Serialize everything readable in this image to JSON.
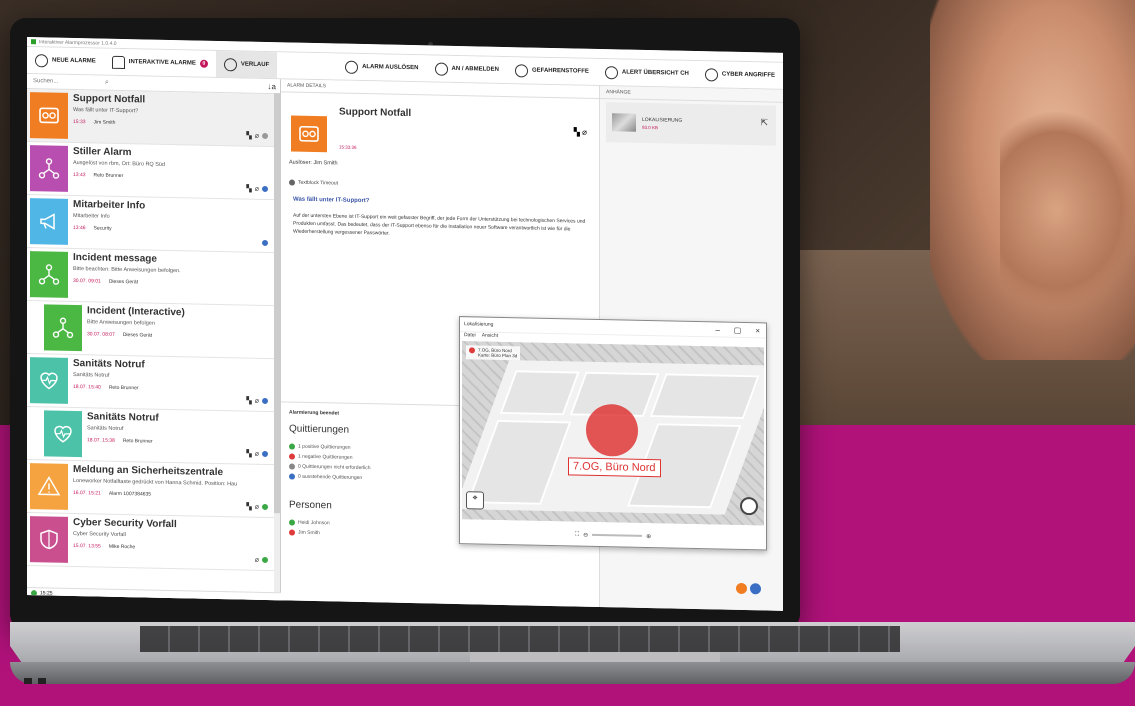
{
  "window_title": "Interaktiver Alarmprozessor 1.0.4.0",
  "toolbar": {
    "left": [
      {
        "label": "NEUE ALARME",
        "icon": "person-alert-icon"
      },
      {
        "label": "INTERAKTIVE ALARME",
        "icon": "bell-icon",
        "badge": "0"
      },
      {
        "label": "VERLAUF",
        "icon": "clock-icon"
      }
    ],
    "right": [
      {
        "label": "ALARM AUSLÖSEN",
        "icon": "hand-icon"
      },
      {
        "label": "AN / ABMELDEN",
        "icon": "users-icon"
      },
      {
        "label": "GEFAHRENSTOFFE",
        "icon": "globe-icon"
      },
      {
        "label": "ALERT ÜBERSICHT CH",
        "icon": "globe-icon"
      },
      {
        "label": "CYBER ANGRIFFE",
        "icon": "globe-icon"
      }
    ]
  },
  "search": {
    "placeholder": "Suchen...",
    "sort_icon": "↓a"
  },
  "alarms": [
    {
      "title": "Support Notfall",
      "sub": "Was fällt unter IT-Support?",
      "time": "15:33",
      "who": "Jim Smith",
      "color": "#f07d22",
      "icon": "stove-icon"
    },
    {
      "title": "Stiller Alarm",
      "sub": "Ausgelöst von rbm, Ort: Büro RQ Süd",
      "time": "13:43",
      "who": "Reto Brunner",
      "color": "#b84fb0",
      "icon": "network-icon"
    },
    {
      "title": "Mitarbeiter Info",
      "sub": "Mitarbeiter Info",
      "time": "13:46",
      "who": "Security",
      "color": "#4fb6e6",
      "icon": "megaphone-icon"
    },
    {
      "title": "Incident message",
      "sub": "Bitte beachten: Bitte Anweisungen befolgen.",
      "time": "30.07. 09:01",
      "who": "Dieses Gerät",
      "color": "#4bb843",
      "icon": "network-icon"
    },
    {
      "title": "Incident (Interactive)",
      "sub": "Bitte Anweisungen befolgen",
      "time": "30.07. 08:07",
      "who": "Dieses Gerät",
      "color": "#4bb843",
      "icon": "network-icon"
    },
    {
      "title": "Sanitäts Notruf",
      "sub": "Sanitäts Notruf",
      "time": "18.07. 15:40",
      "who": "Reto Brunner",
      "color": "#4cc3a8",
      "icon": "heart-icon"
    },
    {
      "title": "Sanitäts Notruf",
      "sub": "Sanitäts Notruf",
      "time": "18.07. 15:38",
      "who": "Reto Brunner",
      "color": "#4cc3a8",
      "icon": "heart-icon"
    },
    {
      "title": "Meldung an Sicherheitszentrale",
      "sub": "Loneworker Notfalltaste gedrückt von Hanna Schmid. Position: Hau",
      "time": "16.07. 15:21",
      "who": "Alarm 1007384635",
      "color": "#f5a240",
      "icon": "warning-icon"
    },
    {
      "title": "Cyber Security Vorfall",
      "sub": "Cyber Security Vorfall",
      "time": "15.07. 13:55",
      "who": "Mike Roche",
      "color": "#c94f8f",
      "icon": "shield-icon"
    }
  ],
  "status": {
    "time": "15:25"
  },
  "details": {
    "header": "ALARM DETAILS",
    "title": "Support Notfall",
    "time": "15:33:36",
    "triggered_by": "Auslöser: Jim Smith",
    "tts": "Textblock Timeout",
    "question": "Was fällt unter IT-Support?",
    "description": "Auf der untersten Ebene ist IT-Support ein weit gefasster Begriff, der jede Form der Unterstützung bei technologischen Services und Produkten umfasst. Das bedeutet, dass der IT-Support ebenso für die Installation neuer Software verantwortlich ist wie für die Wiederherstellung vergessener Passwörter.",
    "ended": "Alarmierung beendet",
    "ack_heading": "Quittierungen",
    "acks": [
      {
        "text": "1 positive Quittierungen",
        "color": "#3aa845"
      },
      {
        "text": "1 negative Quittierungen",
        "color": "#e03b3b"
      },
      {
        "text": "0 Quittierungen nicht erforderlich",
        "color": "#888888"
      },
      {
        "text": "0 ausstehende Quittierungen",
        "color": "#3b6fc4"
      }
    ],
    "persons_heading": "Personen",
    "persons": [
      {
        "text": "Heidi Johnson",
        "color": "#3aa845"
      },
      {
        "text": "Jim Smith",
        "color": "#e03b3b"
      }
    ]
  },
  "attachments": {
    "header": "ANHÄNGE",
    "item_name": "LOKALISIERUNG",
    "item_size": "93.0 KB"
  },
  "map_window": {
    "title": "Lokalisierung",
    "menu": [
      "Datei",
      "Ansicht"
    ],
    "legend_line1": "7.OG, Büro Nord",
    "legend_line2": "Karte: Büro Plan 3d",
    "location_label": "7.OG, Büro Nord",
    "controls": [
      "–",
      "▢",
      "×"
    ]
  }
}
